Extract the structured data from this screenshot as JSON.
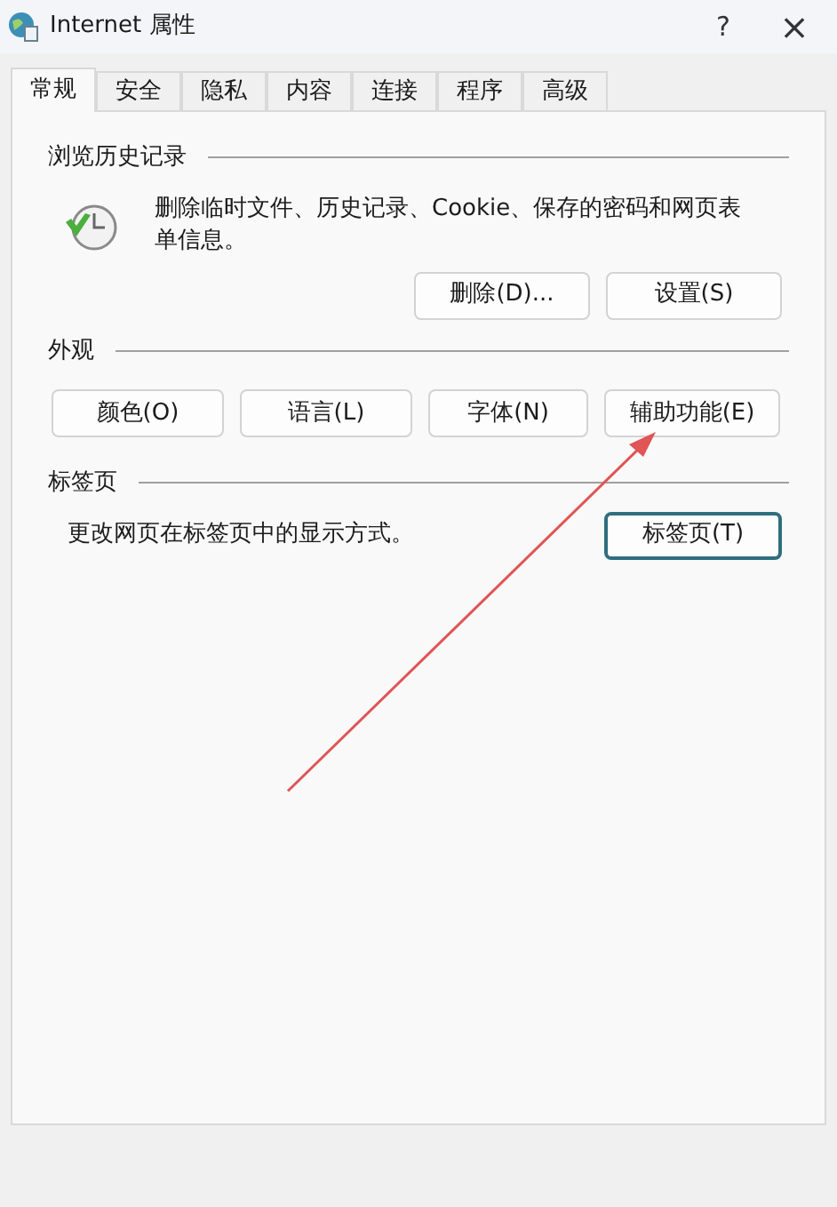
{
  "window": {
    "title": "Internet 属性",
    "help": "?",
    "close": "×"
  },
  "tabs": [
    {
      "label": "常规",
      "selected": true
    },
    {
      "label": "安全",
      "selected": false
    },
    {
      "label": "隐私",
      "selected": false
    },
    {
      "label": "内容",
      "selected": false
    },
    {
      "label": "连接",
      "selected": false
    },
    {
      "label": "程序",
      "selected": false
    },
    {
      "label": "高级",
      "selected": false
    }
  ],
  "history": {
    "heading": "浏览历史记录",
    "description": "删除临时文件、历史记录、Cookie、保存的密码和网页表单信息。",
    "buttons": [
      {
        "label": "删除(D)...",
        "focused": false
      },
      {
        "label": "设置(S)",
        "focused": false
      }
    ]
  },
  "appearance": {
    "heading": "外观",
    "buttons": [
      {
        "label": "颜色(O)",
        "focused": false
      },
      {
        "label": "语言(L)",
        "focused": false
      },
      {
        "label": "字体(N)",
        "focused": false
      },
      {
        "label": "辅助功能(E)",
        "focused": false
      }
    ]
  },
  "tabs_group": {
    "heading": "标签页",
    "description": "更改网页在标签页中的显示方式。",
    "buttons": [
      {
        "label": "标签页(T)",
        "focused": true
      }
    ]
  }
}
